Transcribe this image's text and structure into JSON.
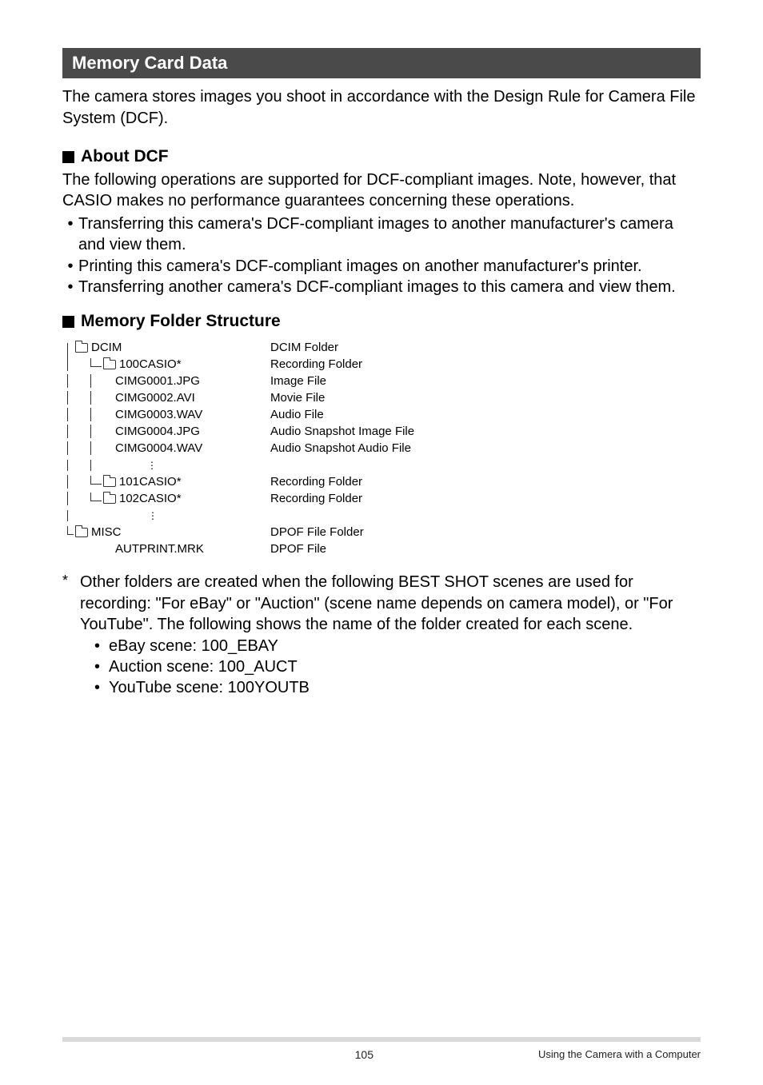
{
  "section": {
    "title": "Memory Card Data"
  },
  "intro": "The camera stores images you shoot in accordance with the Design Rule for Camera File System (DCF).",
  "about_dcf": {
    "heading": "About DCF",
    "text": "The following operations are supported for DCF-compliant images. Note, however, that CASIO makes no performance guarantees concerning these operations.",
    "items": [
      "Transferring this camera's DCF-compliant images to another manufacturer's camera and view them.",
      "Printing this camera's DCF-compliant images on another manufacturer's printer.",
      "Transferring another camera's DCF-compliant images to this camera and view them."
    ]
  },
  "folder_structure": {
    "heading": "Memory Folder Structure",
    "tree": [
      {
        "name": "DCIM",
        "desc": "DCIM Folder"
      },
      {
        "name": "100CASIO",
        "star": "*",
        "desc": "Recording Folder"
      },
      {
        "name": "CIMG0001.JPG",
        "desc": "Image File"
      },
      {
        "name": "CIMG0002.AVI",
        "desc": "Movie File"
      },
      {
        "name": "CIMG0003.WAV",
        "desc": "Audio File"
      },
      {
        "name": "CIMG0004.JPG",
        "desc": "Audio Snapshot Image File"
      },
      {
        "name": "CIMG0004.WAV",
        "desc": "Audio Snapshot Audio File"
      },
      {
        "name": "101CASIO",
        "star": "*",
        "desc": "Recording Folder"
      },
      {
        "name": "102CASIO",
        "star": "*",
        "desc": "Recording Folder"
      },
      {
        "name": "MISC",
        "desc": "DPOF File Folder"
      },
      {
        "name": "AUTPRINT.MRK",
        "desc": "DPOF File"
      }
    ]
  },
  "footnote": {
    "star": "*",
    "text": "Other folders are created when the following BEST SHOT scenes are used for recording: \"For eBay\" or \"Auction\" (scene name depends on camera model), or \"For YouTube\". The following shows the name of the folder created for each scene.",
    "items": [
      "eBay scene: 100_EBAY",
      "Auction scene: 100_AUCT",
      "YouTube scene: 100YOUTB"
    ]
  },
  "footer": {
    "page": "105",
    "section": "Using the Camera with a Computer"
  }
}
